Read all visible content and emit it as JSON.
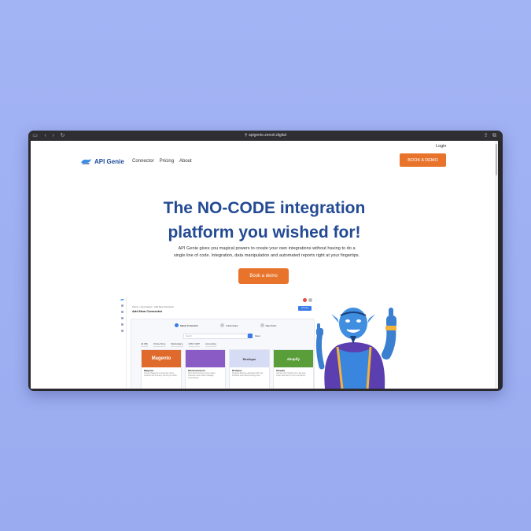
{
  "browser": {
    "url": "apigenie.zenoti.digital"
  },
  "header": {
    "login": "Login",
    "logo_text": "API Genie",
    "nav": [
      "Connector",
      "Pricing",
      "About"
    ],
    "book_demo": "BOOK A DEMO"
  },
  "hero": {
    "title_line1": "The NO-CODE integration",
    "title_line2": "platform you wished for!",
    "subtitle_line1": "API Genie gives you magical powers to create your own integrations without having to do a",
    "subtitle_line2": "single line of code. Integration, data manipulation and automated reports right at your fingertips.",
    "cta": "Book a demo"
  },
  "preview": {
    "breadcrumb": "Home  >  Connectors  >  Add New Connector",
    "heading": "Add New Connector",
    "add_button": "Connect",
    "steps": [
      "Select Connector",
      "Authenticate",
      "Map Fields"
    ],
    "search_placeholder": "Search",
    "clear": "Clear",
    "tabs": [
      "All (85)",
      "Online Shop",
      "Marketplace",
      "CRM / ERP",
      "Accounting"
    ],
    "tiles": [
      {
        "name": "Magento",
        "banner": "Magento",
        "desc": "Connect Magento to automate orders, products and inventory across your stack."
      },
      {
        "name": "WooCommerce",
        "banner": "",
        "desc": "Sync WooCommerce store orders, customers and product catalogs automatically."
      },
      {
        "name": "Reclique",
        "banner": "Reclique",
        "desc": "Integrate Reclique data flows with your business tools without writing code."
      },
      {
        "name": "Shopify",
        "banner": "shopify",
        "desc": "Connect your Shopify store and keep orders and stock in sync everywhere."
      }
    ]
  },
  "colors": {
    "accent": "#e8742c",
    "brand": "#234a93",
    "background": "#a3b4f5"
  }
}
